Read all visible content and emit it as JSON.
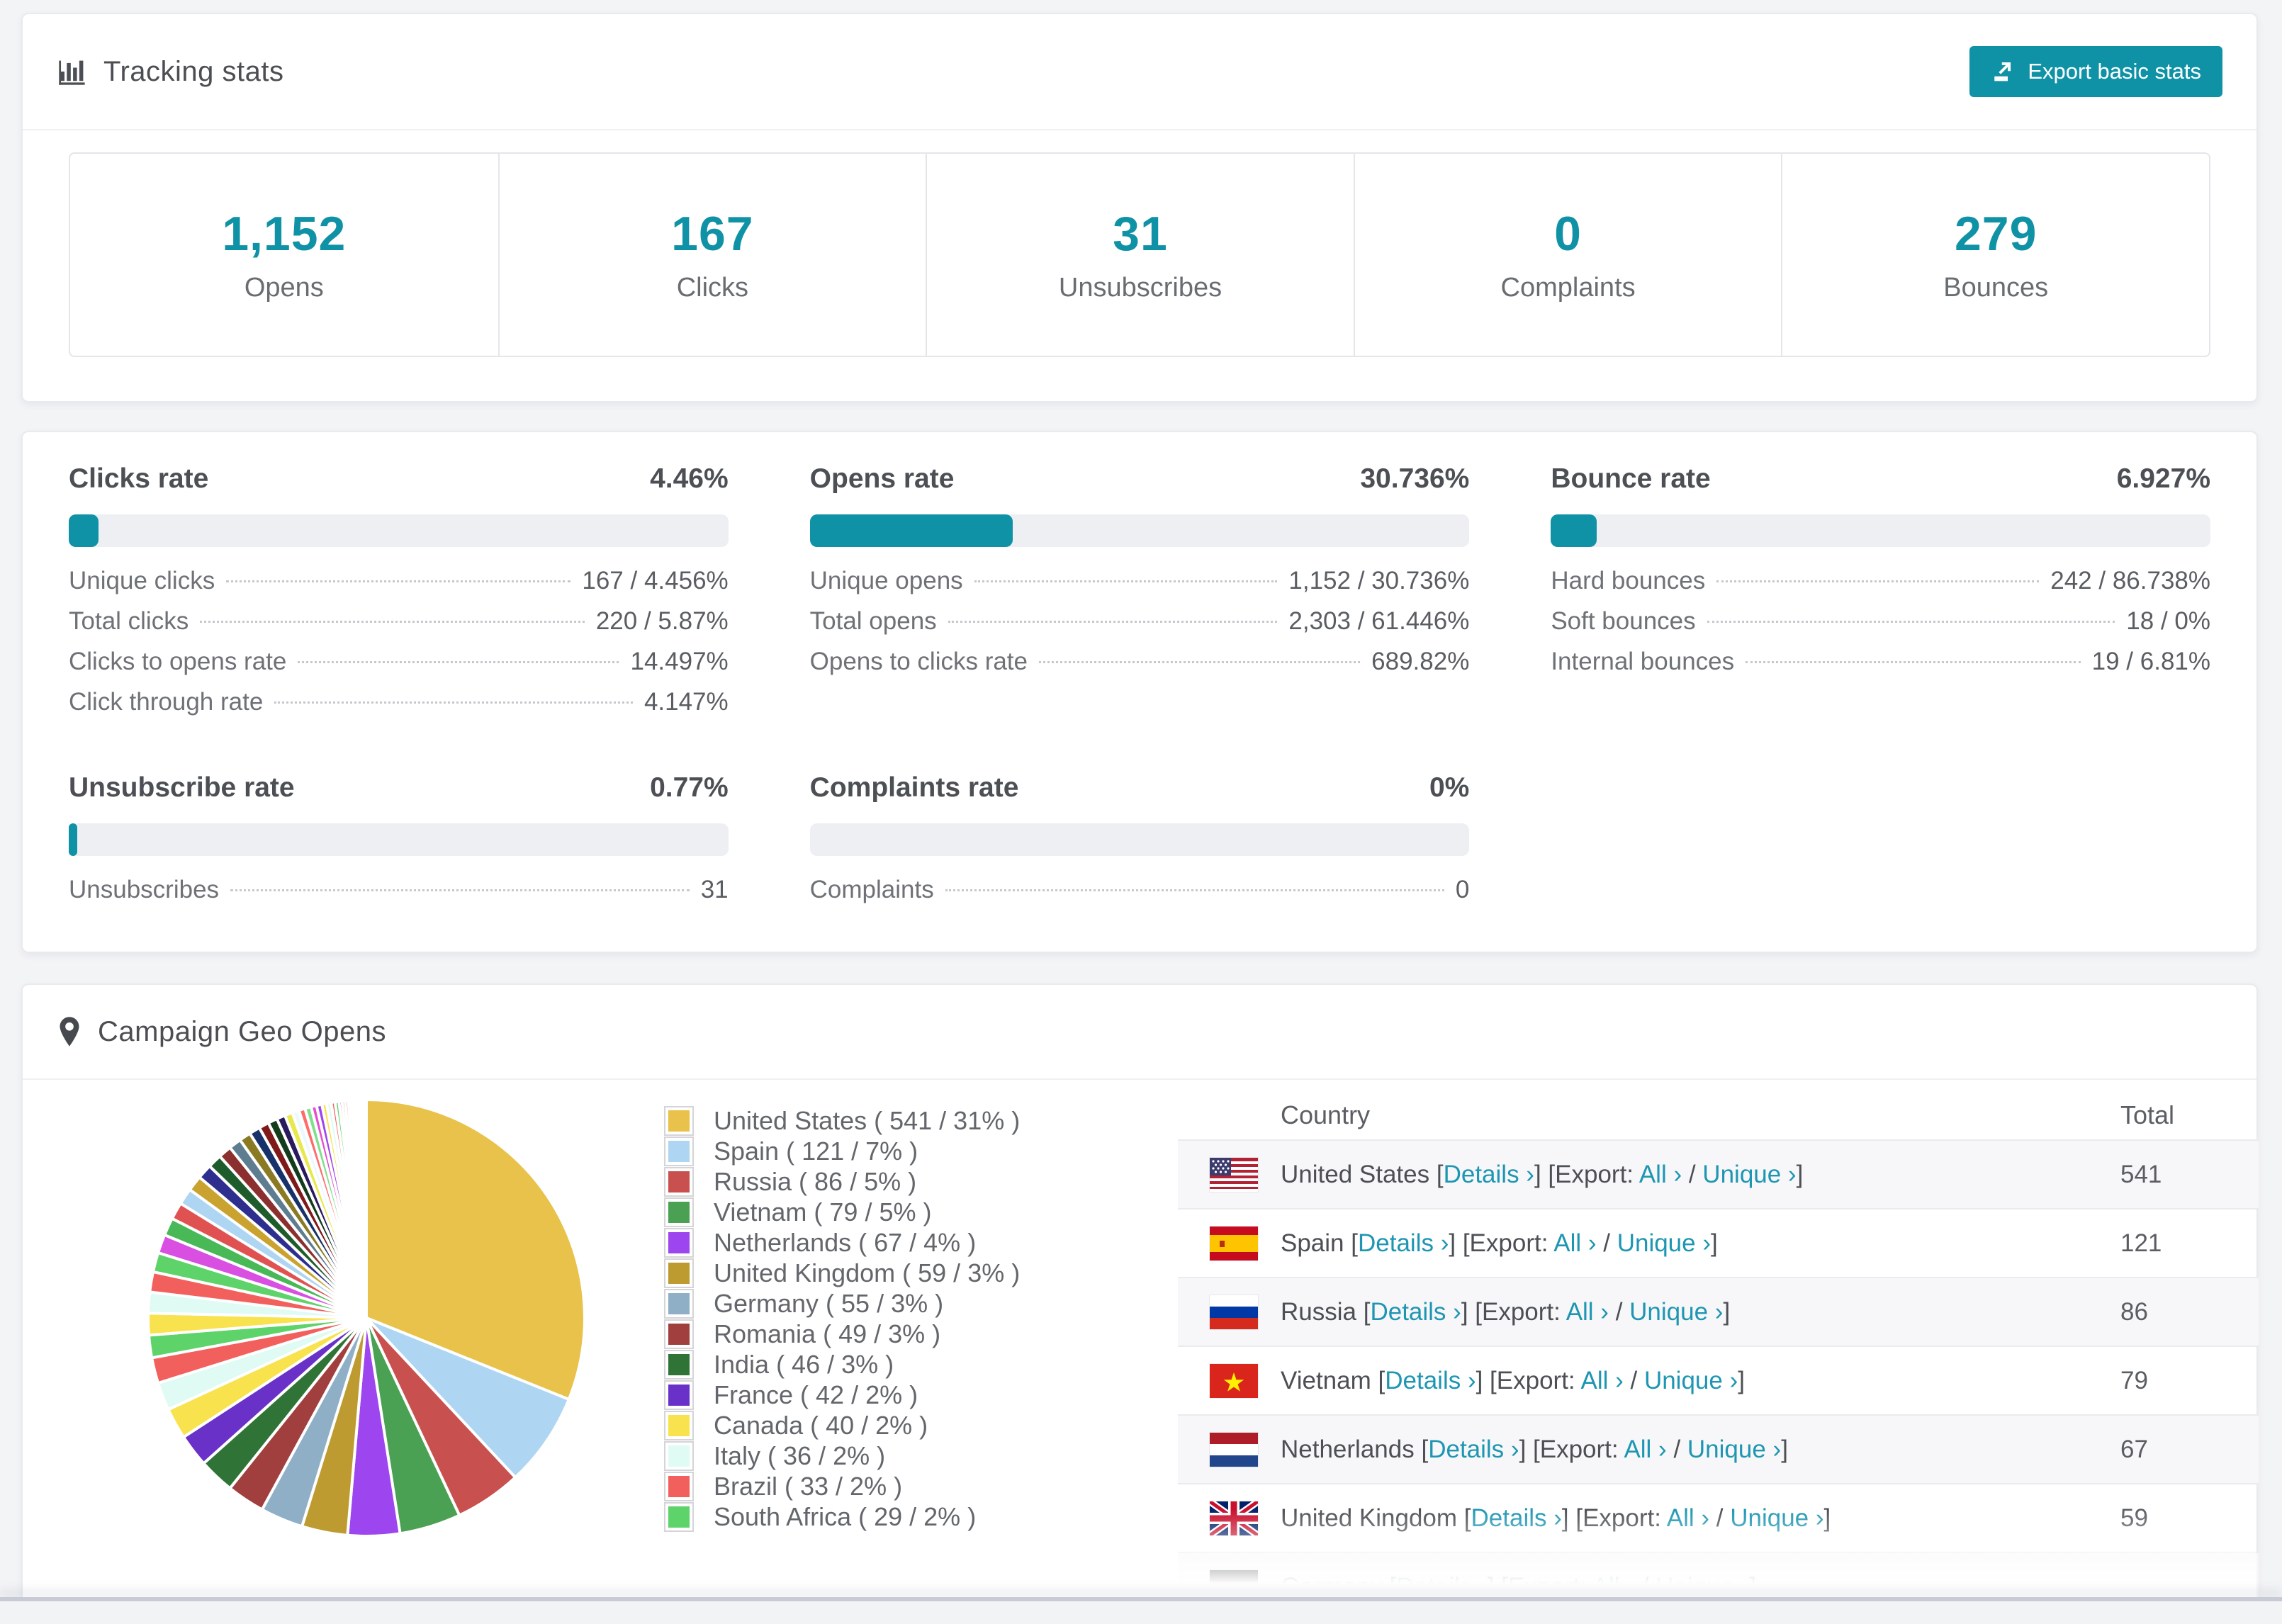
{
  "colors": {
    "accent": "#1092a6",
    "link": "#1e96b2",
    "page_bg": "#f3f4f6",
    "bar_track": "#edeff3"
  },
  "header": {
    "title": "Tracking stats",
    "export_label": "Export basic stats"
  },
  "summary": [
    {
      "value": "1,152",
      "label": "Opens"
    },
    {
      "value": "167",
      "label": "Clicks"
    },
    {
      "value": "31",
      "label": "Unsubscribes"
    },
    {
      "value": "0",
      "label": "Complaints"
    },
    {
      "value": "279",
      "label": "Bounces"
    }
  ],
  "rates": [
    {
      "title": "Clicks rate",
      "percent_label": "4.46%",
      "percent": 4.46,
      "rows": [
        [
          "Unique clicks",
          "167 / 4.456%"
        ],
        [
          "Total clicks",
          "220 / 5.87%"
        ],
        [
          "Clicks to opens rate",
          "14.497%"
        ],
        [
          "Click through rate",
          "4.147%"
        ]
      ]
    },
    {
      "title": "Opens rate",
      "percent_label": "30.736%",
      "percent": 30.736,
      "rows": [
        [
          "Unique opens",
          "1,152 / 30.736%"
        ],
        [
          "Total opens",
          "2,303 / 61.446%"
        ],
        [
          "Opens to clicks rate",
          "689.82%"
        ]
      ]
    },
    {
      "title": "Bounce rate",
      "percent_label": "6.927%",
      "percent": 6.927,
      "rows": [
        [
          "Hard bounces",
          "242 / 86.738%"
        ],
        [
          "Soft bounces",
          "18 / 0%"
        ],
        [
          "Internal bounces",
          "19 / 6.81%"
        ]
      ]
    },
    {
      "title": "Unsubscribe rate",
      "percent_label": "0.77%",
      "percent": 0.77,
      "rows": [
        [
          "Unsubscribes",
          "31"
        ]
      ]
    },
    {
      "title": "Complaints rate",
      "percent_label": "0%",
      "percent": 0,
      "rows": [
        [
          "Complaints",
          "0"
        ]
      ]
    }
  ],
  "geo": {
    "title": "Campaign Geo Opens",
    "chart_data": {
      "type": "pie",
      "title": "Campaign Geo Opens",
      "categories": [
        "United States",
        "Spain",
        "Russia",
        "Vietnam",
        "Netherlands",
        "United Kingdom",
        "Germany",
        "Romania",
        "India",
        "France",
        "Canada",
        "Italy",
        "Brazil",
        "South Africa"
      ],
      "values": [
        541,
        121,
        86,
        79,
        67,
        59,
        55,
        49,
        46,
        42,
        40,
        36,
        33,
        29
      ],
      "percent_labels": [
        "31%",
        "7%",
        "5%",
        "5%",
        "4%",
        "3%",
        "3%",
        "3%",
        "3%",
        "2%",
        "2%",
        "2%",
        "2%",
        "2%"
      ],
      "colors": [
        "#e8c24a",
        "#aed5f2",
        "#c8504f",
        "#4ba153",
        "#9d45ee",
        "#bd9b31",
        "#8fafc6",
        "#a03f3e",
        "#2f7436",
        "#6931c8",
        "#f8e24d",
        "#dffbf3",
        "#f2605e",
        "#5dd36a"
      ],
      "others_values": [
        28,
        27,
        26,
        25,
        24,
        23,
        22,
        21,
        20,
        19,
        18,
        17,
        16,
        15,
        14,
        13,
        12,
        11,
        10,
        9,
        8,
        8,
        7,
        7,
        6,
        6,
        5,
        5,
        4,
        4,
        4,
        3,
        3,
        3,
        2,
        2,
        2,
        2,
        1,
        1,
        1,
        1,
        1,
        1
      ],
      "others_palette": [
        "#f8e24d",
        "#dffbf3",
        "#f2605e",
        "#5dd36a",
        "#d84fe2",
        "#49b857",
        "#e05252",
        "#aed5f2",
        "#c9a22f",
        "#2e2e8f",
        "#1f5c2b",
        "#8c2f2f",
        "#5e7d91",
        "#8a7a24",
        "#17326b",
        "#801a1a",
        "#123c1c",
        "#2a1a5e",
        "#e8e84d",
        "#eef9ff",
        "#ff6b6b",
        "#7ee08a",
        "#e44fd0",
        "#9d45ee"
      ],
      "legend_position": "right",
      "start_angle_deg": -90,
      "direction": "clockwise"
    },
    "legend": [
      "United States ( 541 / 31% )",
      "Spain ( 121 / 7% )",
      "Russia ( 86 / 5% )",
      "Vietnam ( 79 / 5% )",
      "Netherlands ( 67 / 4% )",
      "United Kingdom ( 59 / 3% )",
      "Germany ( 55 / 3% )",
      "Romania ( 49 / 3% )",
      "India ( 46 / 3% )",
      "France ( 42 / 2% )",
      "Canada ( 40 / 2% )",
      "Italy ( 36 / 2% )",
      "Brazil ( 33 / 2% )",
      "South Africa ( 29 / 2% )"
    ],
    "table": {
      "headers": [
        "Country",
        "Total"
      ],
      "links": {
        "details": "Details",
        "export": "[Export:",
        "all": "All",
        "unique": "Unique",
        "chevron": "›"
      },
      "rows": [
        {
          "country": "United States",
          "flag": "us",
          "total": "541"
        },
        {
          "country": "Spain",
          "flag": "es",
          "total": "121"
        },
        {
          "country": "Russia",
          "flag": "ru",
          "total": "86"
        },
        {
          "country": "Vietnam",
          "flag": "vn",
          "total": "79"
        },
        {
          "country": "Netherlands",
          "flag": "nl",
          "total": "67"
        },
        {
          "country": "United Kingdom",
          "flag": "gb",
          "total": "59"
        },
        {
          "country": "Germany",
          "flag": "de",
          "total": ""
        }
      ]
    }
  }
}
